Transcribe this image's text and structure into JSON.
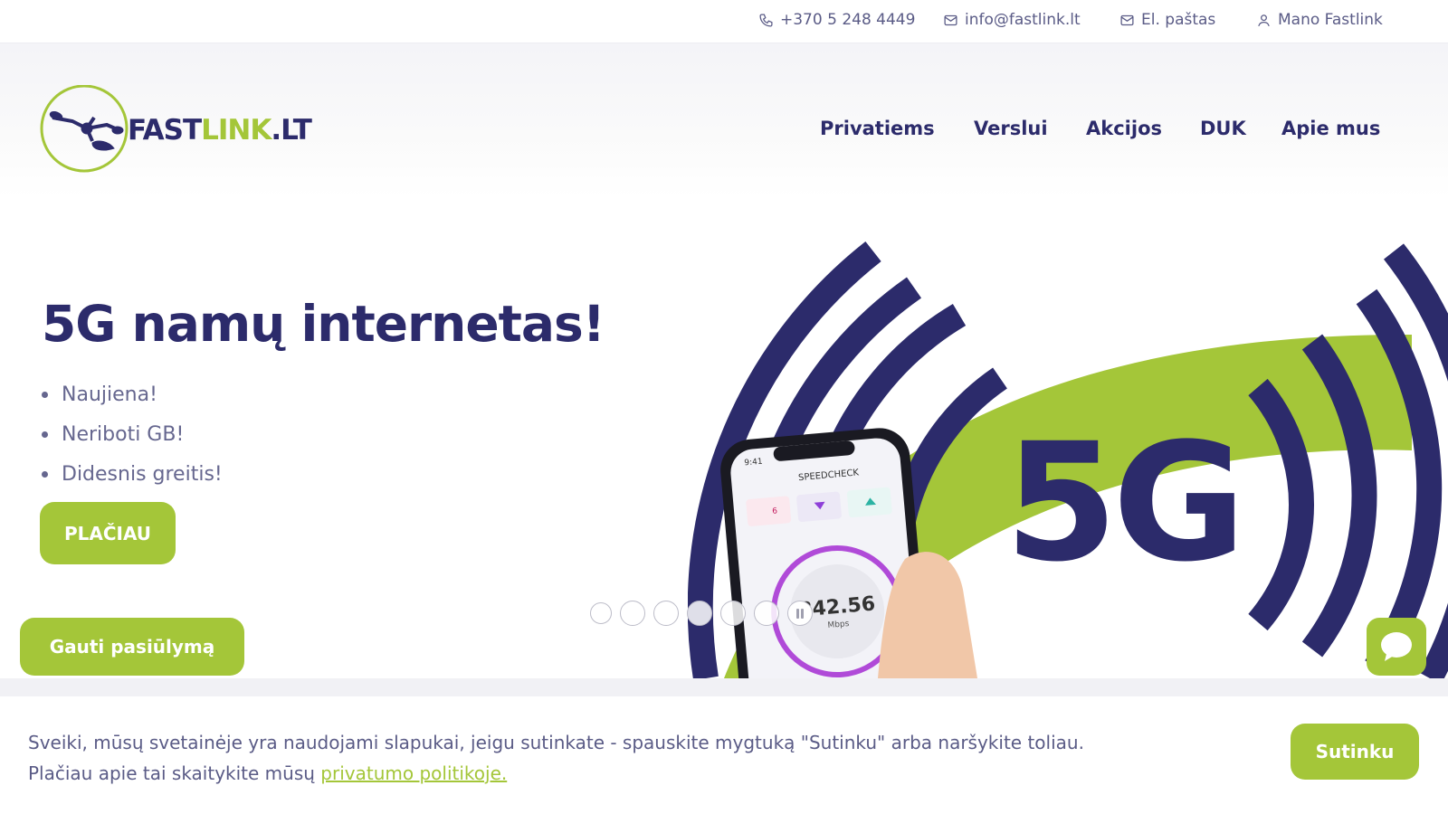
{
  "topbar": {
    "phone": "+370 5 248 4449",
    "email": "info@fastlink.lt",
    "webmail": "El. paštas",
    "account": "Mano Fastlink"
  },
  "logo": {
    "text_fast": "FAST",
    "text_link": "LINK",
    "text_lt": ".LT"
  },
  "nav": {
    "items": [
      "Privatiems",
      "Verslui",
      "Akcijos",
      "DUK",
      "Apie mus"
    ]
  },
  "hero": {
    "title": "5G namų internetas!",
    "bullets": [
      "Naujiena!",
      "Neriboti GB!",
      "Didesnis greitis!"
    ],
    "more_button": "PLAČIAU",
    "phone_time": "9:41",
    "phone_app": "SPEEDCHECK",
    "phone_speed": "842.56",
    "phone_unit": "Mbps",
    "phone_small_value": "6",
    "art_text": "5G",
    "slides": 6
  },
  "offer_button": "Gauti pasiūlymą",
  "cookie": {
    "line1": "Sveiki, mūsų svetainėje yra naudojami slapukai, jeigu sutinkate - spauskite mygtuką \"Sutinku\" arba naršykite toliau.",
    "line2_prefix": "Plačiau apie tai skaitykite mūsų ",
    "line2_link": "privatumo politikoje.",
    "agree_button": "Sutinku"
  },
  "colors": {
    "brand_green": "#a4c639",
    "brand_navy": "#2c2b6b",
    "text_muted": "#5a5b86"
  }
}
